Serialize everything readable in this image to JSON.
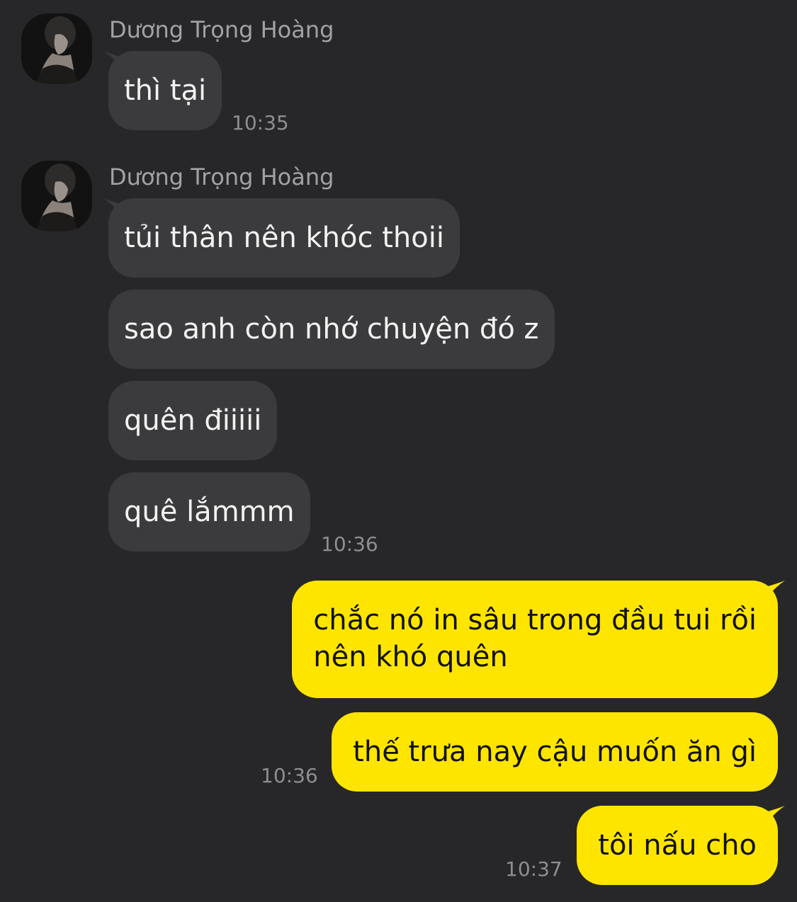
{
  "chat": {
    "groups": [
      {
        "sender": "Dương Trọng Hoàng",
        "avatar_icon": "profile-photo-avatar",
        "messages": [
          "thì tại"
        ],
        "time": "10:35"
      },
      {
        "sender": "Dương Trọng Hoàng",
        "avatar_icon": "profile-photo-avatar",
        "messages": [
          "tủi thân nên khóc thoii",
          "sao anh còn nhớ chuyện đó z",
          "quên điiiii",
          "quê lắmmm"
        ],
        "time": "10:36"
      }
    ],
    "outgoing": [
      {
        "lines": [
          "chắc nó in sâu trong đầu tui rồi",
          "nên khó quên"
        ],
        "time": ""
      },
      {
        "lines": [
          "thế trưa nay cậu muốn ăn gì"
        ],
        "time": "10:36"
      },
      {
        "lines": [
          "tôi nấu cho"
        ],
        "time": "10:37"
      }
    ]
  },
  "colors": {
    "background": "#272729",
    "incoming_bubble": "#3b3b3d",
    "outgoing_bubble": "#fee500",
    "sender_name": "#a2a2a6",
    "timestamp": "#8e8e92"
  }
}
